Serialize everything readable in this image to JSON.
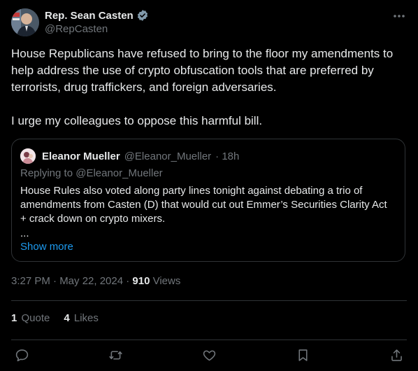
{
  "author": {
    "name": "Rep. Sean Casten",
    "handle": "@RepCasten",
    "verified_icon": "verified-badge-icon"
  },
  "tweet": {
    "text": "House Republicans have refused to bring to the floor my amendments to help address the use of crypto obfuscation tools that are preferred by terrorists, drug traffickers, and foreign adversaries.\n\nI urge my colleagues to oppose this harmful bill."
  },
  "quoted": {
    "name": "Eleanor Mueller",
    "handle": "@Eleanor_Mueller",
    "time": "· 18h",
    "replying_to": "Replying to @Eleanor_Mueller",
    "body": "House Rules also voted along party lines tonight against debating a trio of amendments from Casten (D) that would cut out Emmer’s Securities Clarity Act + crack down on crypto mixers.",
    "ellipsis": "...",
    "show_more": "Show more"
  },
  "meta": {
    "timestamp": "3:27 PM · May 22, 2024 · ",
    "views_count": "910",
    "views_label": " Views"
  },
  "stats": {
    "quotes_count": "1",
    "quotes_label": " Quote",
    "likes_count": "4",
    "likes_label": " Likes"
  },
  "colors": {
    "background": "#000000",
    "text": "#e7e9ea",
    "muted": "#71767b",
    "link": "#1d9bf0",
    "border": "#2f3336",
    "verified": "#829aab"
  },
  "icons": [
    "more-icon",
    "reply-icon",
    "retweet-icon",
    "like-icon",
    "bookmark-icon",
    "share-icon"
  ]
}
